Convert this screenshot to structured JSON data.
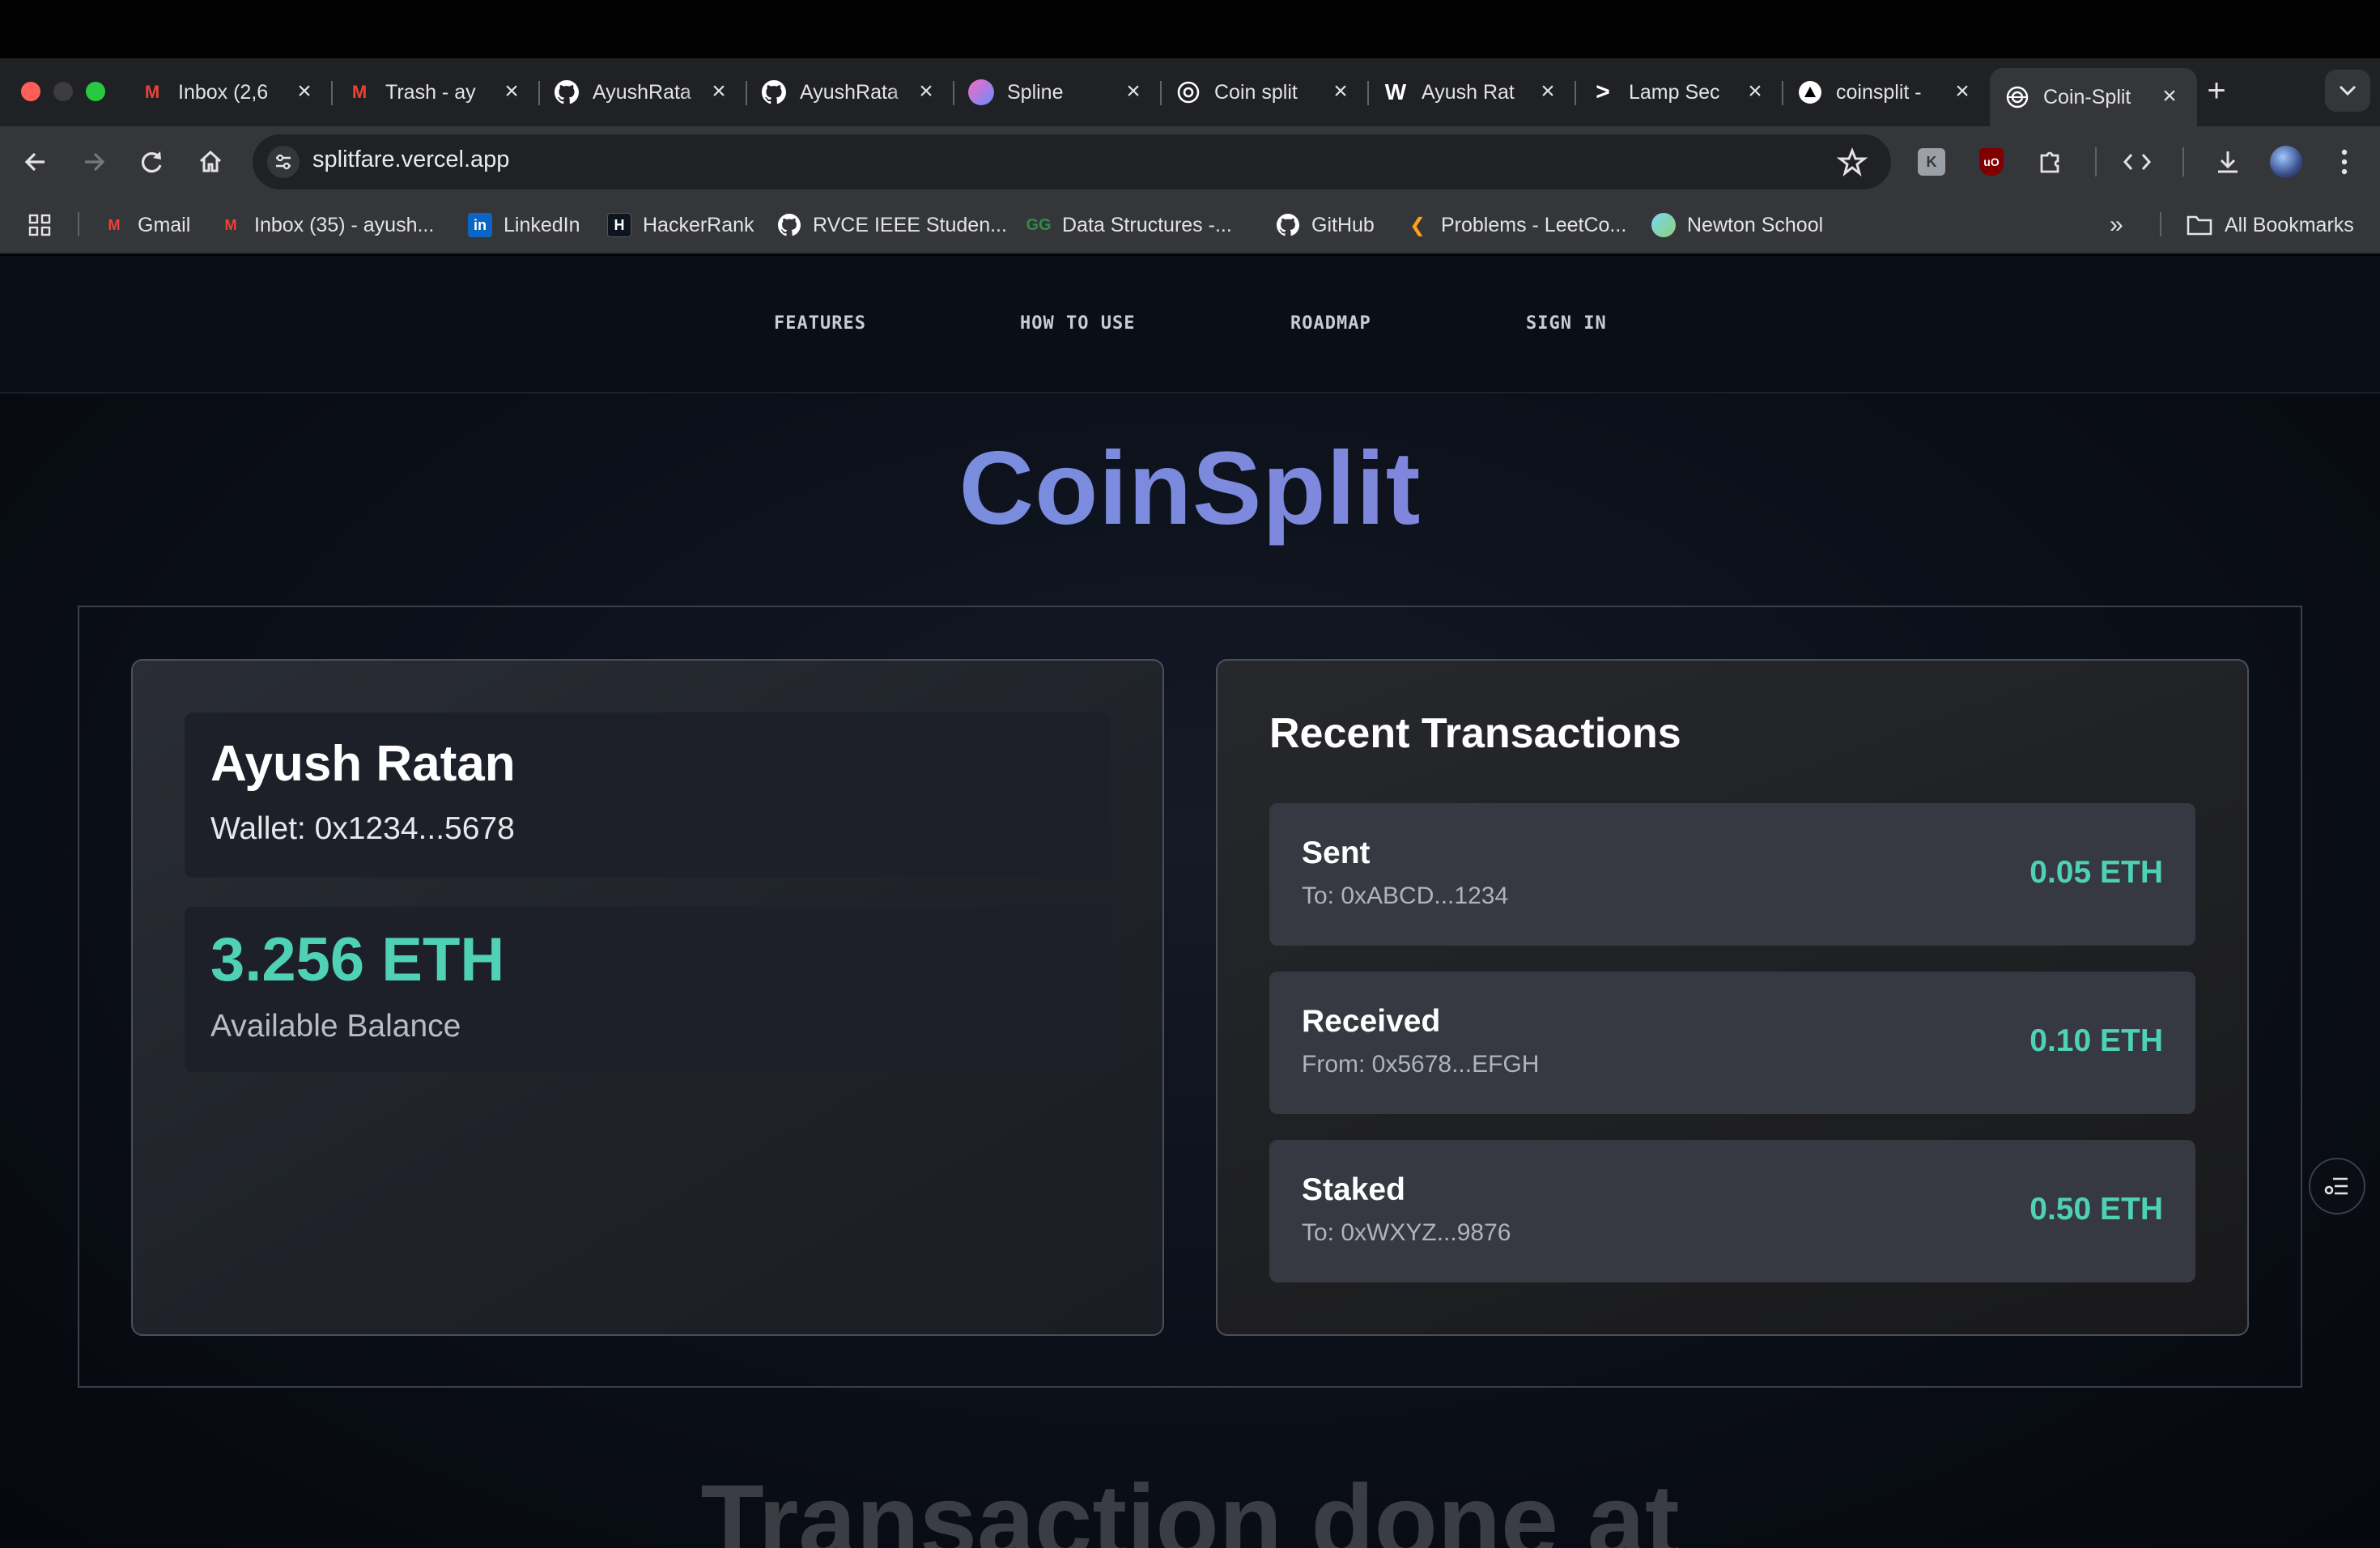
{
  "browser": {
    "tabs": [
      {
        "title": "Inbox (2,6",
        "icon": "gmail-icon",
        "color": "#ea4335"
      },
      {
        "title": "Trash - ay",
        "icon": "gmail-icon",
        "color": "#ea4335"
      },
      {
        "title": "AyushRata",
        "icon": "github-icon",
        "color": "#ffffff"
      },
      {
        "title": "AyushRata",
        "icon": "github-icon",
        "color": "#ffffff"
      },
      {
        "title": "Spline",
        "icon": "spline-icon",
        "color": "#8a6cf6"
      },
      {
        "title": "Coin split",
        "icon": "openai-icon",
        "color": "#ffffff"
      },
      {
        "title": "Ayush Rat",
        "icon": "w-icon",
        "color": "#ffffff"
      },
      {
        "title": "Lamp Sec",
        "icon": "terminal-icon",
        "color": "#ffffff"
      },
      {
        "title": "coinsplit -",
        "icon": "vercel-icon",
        "color": "#ffffff"
      },
      {
        "title": "Coin-Split",
        "icon": "coin-icon",
        "color": "#ffffff"
      }
    ],
    "url": "splitfare.vercel.app",
    "bookmarks": [
      {
        "label": "Gmail",
        "icon": "gmail-icon"
      },
      {
        "label": "Inbox (35) - ayush...",
        "icon": "gmail-icon"
      },
      {
        "label": "LinkedIn",
        "icon": "linkedin-icon"
      },
      {
        "label": "HackerRank",
        "icon": "hackerrank-icon"
      },
      {
        "label": "RVCE IEEE Studen...",
        "icon": "github-icon"
      },
      {
        "label": "Data Structures -...",
        "icon": "gfg-icon"
      },
      {
        "label": "GitHub",
        "icon": "github-icon"
      },
      {
        "label": "Problems - LeetCo...",
        "icon": "leetcode-icon"
      },
      {
        "label": "Newton School",
        "icon": "newton-icon"
      }
    ],
    "all_bookmarks": "All Bookmarks"
  },
  "site": {
    "nav": [
      "FEATURES",
      "HOW TO USE",
      "ROADMAP",
      "SIGN IN"
    ],
    "brand": "CoinSplit",
    "profile": {
      "name": "Ayush Ratan",
      "wallet": "Wallet: 0x1234...5678",
      "balance": "3.256 ETH",
      "balance_label": "Available Balance"
    },
    "recent": {
      "title": "Recent Transactions",
      "items": [
        {
          "kind": "Sent",
          "addr": "To: 0xABCD...1234",
          "amount": "0.05 ETH"
        },
        {
          "kind": "Received",
          "addr": "From: 0x5678...EFGH",
          "amount": "0.10 ETH"
        },
        {
          "kind": "Staked",
          "addr": "To: 0xWXYZ...9876",
          "amount": "0.50 ETH"
        }
      ]
    },
    "bottom_heading": "Transaction done at"
  },
  "colors": {
    "accent": "#4fd1b5",
    "brand_gradient_start": "#6f93de",
    "brand_gradient_end": "#8b76d8"
  }
}
